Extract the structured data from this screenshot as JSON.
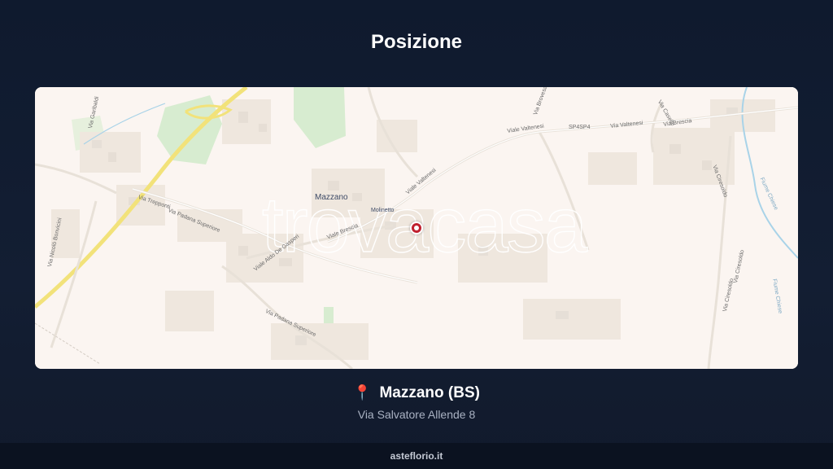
{
  "page": {
    "title": "Posizione"
  },
  "map": {
    "watermark": "trovacasa",
    "places": {
      "mazzano": "Mazzano",
      "molinetto": "Molinetto"
    },
    "streets": {
      "via_trepponti": "Via Trepponti",
      "via_padana_superiore_1": "Via Padana Superiore",
      "via_padana_superiore_2": "Via Padana Superiore",
      "via_brescia_1": "Viale Brescia",
      "via_aldo_de_gasperi": "Viale Aldo De Gasperi",
      "viale_valtenesi_1": "Viale Valtenesi",
      "viale_valtenesi_2": "Viale Valtenesi",
      "viale_valtenesi_3": "Via Valtenesi",
      "sp4sp4": "SP4SP4",
      "via_brescia_2": "Via Brescia",
      "via_nicolo_bonvicini": "Via Nicolò Bonvicini",
      "via_garibaldi": "Via Garibaldi",
      "via_ciresoldo_1": "Via Ciresoldo",
      "via_ciresoldo_2": "Via Ciresoldo",
      "via_ciresoldo_3": "Via Ciresoldo",
      "via_brovesa": "Via Brovesa",
      "via_caselle": "Via Caselle",
      "fiume_chiese_1": "Fiume Chiese",
      "fiume_chiese_2": "Fiume Chiese"
    }
  },
  "location": {
    "pin_icon": "📍",
    "city": "Mazzano (BS)",
    "address": "Via Salvatore Allende 8"
  },
  "footer": {
    "brand": "asteflorio.it"
  },
  "colors": {
    "background": "#0f1a2e",
    "map_base": "#fbf5f1",
    "highway": "#f2e27a",
    "park": "#d7ecd0",
    "pin": "#c0202e",
    "water": "#a9d3e8"
  }
}
